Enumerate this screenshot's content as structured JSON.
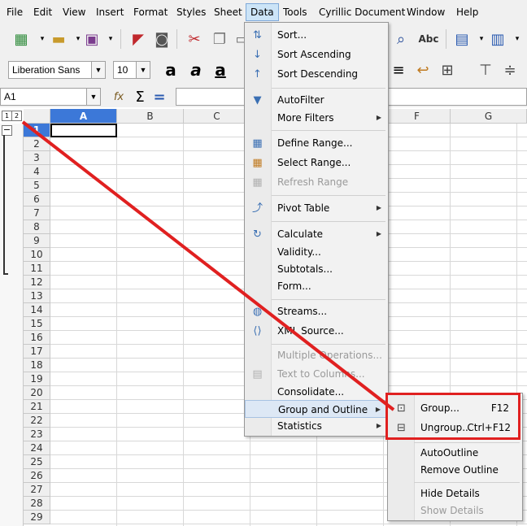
{
  "menubar": [
    "File",
    "Edit",
    "View",
    "Insert",
    "Format",
    "Styles",
    "Sheet",
    "Data",
    "Tools",
    "Cyrillic Document",
    "Window",
    "Help"
  ],
  "font_name": "Liberation Sans",
  "font_size": "10",
  "cell_ref": "A1",
  "outline_levels": [
    "1",
    "2"
  ],
  "outline_collapse": "−",
  "columns": [
    "A",
    "B",
    "C",
    "D",
    "E",
    "F",
    "G"
  ],
  "rows": [
    "1",
    "2",
    "3",
    "4",
    "5",
    "6",
    "7",
    "8",
    "9",
    "10",
    "11",
    "12",
    "13",
    "14",
    "15",
    "16",
    "17",
    "18",
    "19",
    "20",
    "21",
    "22",
    "23",
    "24",
    "25",
    "26",
    "27",
    "28",
    "29"
  ],
  "data_menu": {
    "sort": "Sort...",
    "sort_asc": "Sort Ascending",
    "sort_desc": "Sort Descending",
    "autofilter": "AutoFilter",
    "more_filters": "More Filters",
    "define_range": "Define Range...",
    "select_range": "Select Range...",
    "refresh_range": "Refresh Range",
    "pivot_table": "Pivot Table",
    "calculate": "Calculate",
    "validity": "Validity...",
    "subtotals": "Subtotals...",
    "form": "Form...",
    "streams": "Streams...",
    "xml_source": "XML Source...",
    "multiple_operations": "Multiple Operations...",
    "text_to_columns": "Text to Columns...",
    "consolidate": "Consolidate...",
    "group_outline": "Group and Outline",
    "statistics": "Statistics"
  },
  "submenu": {
    "group": "Group...",
    "group_key": "F12",
    "ungroup": "Ungroup...",
    "ungroup_key": "Ctrl+F12",
    "auto_outline": "AutoOutline",
    "remove_outline": "Remove Outline",
    "hide_details": "Hide Details",
    "show_details": "Show Details"
  },
  "icons": {
    "sum": "Σ",
    "equals": "=",
    "function": "fx",
    "bold_a": "a",
    "check_abc": "Abc"
  },
  "accent_selection": "#3c78d8",
  "highlight_red": "#e02020"
}
